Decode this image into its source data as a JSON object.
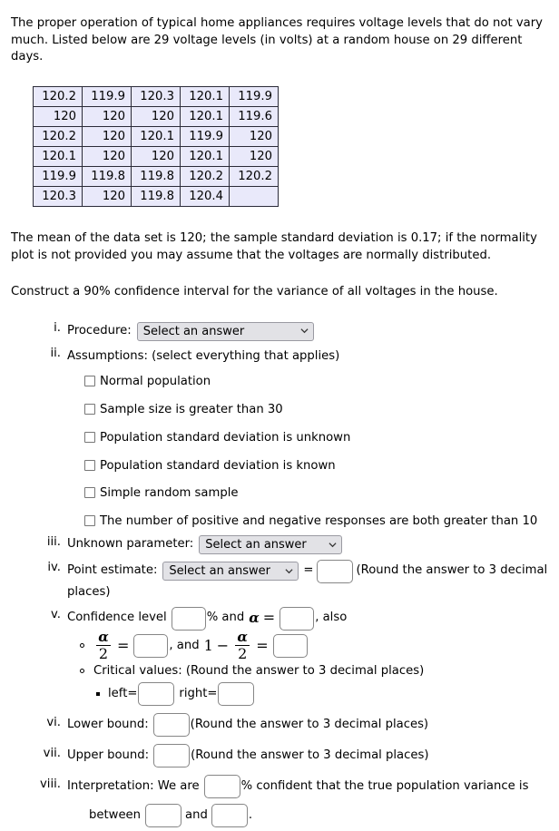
{
  "intro": {
    "paragraph": "The proper operation of typical home appliances requires voltage levels that do not vary much. Listed below are 29 voltage levels (in volts) at a random house on 29 different days."
  },
  "data_table": {
    "rows": [
      [
        "120.2",
        "119.9",
        "120.3",
        "120.1",
        "119.9"
      ],
      [
        "120",
        "120",
        "120",
        "120.1",
        "119.6"
      ],
      [
        "120.2",
        "120",
        "120.1",
        "119.9",
        "120"
      ],
      [
        "120.1",
        "120",
        "120",
        "120.1",
        "120"
      ],
      [
        "119.9",
        "119.8",
        "119.8",
        "120.2",
        "120.2"
      ],
      [
        "120.3",
        "120",
        "119.8",
        "120.4",
        ""
      ]
    ],
    "background_color": "#e9e9fa",
    "border_color": "#2b2b38"
  },
  "stats": {
    "summary": "The mean of the data set is 120; the sample standard deviation is 0.17; if the normality plot is not provided you may assume that the voltages are normally distributed.",
    "task": "Construct a 90% confidence interval for the variance of all voltages in the house."
  },
  "steps": {
    "procedure": {
      "num": "i.",
      "label": "Procedure:",
      "select_value": "Select an answer"
    },
    "assumptions": {
      "num": "ii.",
      "label": "Assumptions: (select everything that applies)",
      "options": [
        "Normal population",
        "Sample size is greater than 30",
        "Population standard deviation is unknown",
        "Population standard deviation is known",
        "Simple random sample",
        "The number of positive and negative responses are both greater than 10"
      ]
    },
    "unknown_parameter": {
      "num": "iii.",
      "label": "Unknown parameter:",
      "select_value": "Select an answer"
    },
    "point_estimate": {
      "num": "iv.",
      "label": "Point estimate:",
      "select_value": "Select an answer",
      "equals": "=",
      "input_value": "",
      "note": "(Round the answer to 3 decimal",
      "note_cont": "places)"
    },
    "confidence_level": {
      "num": "v.",
      "label": "Confidence level",
      "input_value": "",
      "percent_and": "% and",
      "alpha_symbol": "α",
      "equals": "=",
      "alpha_value": "",
      "also": ", also",
      "alpha_over_two": {
        "numerator": "α",
        "denominator": "2",
        "equals": "=",
        "value": "",
        "comma_and": ", and",
        "one": "1",
        "minus": "−",
        "value2": ""
      },
      "critical_values": {
        "label": "Critical values: (Round the answer to 3 decimal places)",
        "left_label": "left=",
        "left_value": "",
        "right_label": "right=",
        "right_value": ""
      }
    },
    "lower_bound": {
      "num": "vi.",
      "label": "Lower bound:",
      "input_value": "",
      "note": "(Round the answer to 3 decimal places)"
    },
    "upper_bound": {
      "num": "vii.",
      "label": "Upper bound:",
      "input_value": "",
      "note": "(Round the answer to 3 decimal places)"
    },
    "interpretation": {
      "num": "viii.",
      "label": "Interpretation: We are",
      "confidence_value": "",
      "mid_text": "% confident that the true population variance is",
      "between_label": "between",
      "lower_value": "",
      "and_label": "and",
      "upper_value": "",
      "period": "."
    }
  }
}
